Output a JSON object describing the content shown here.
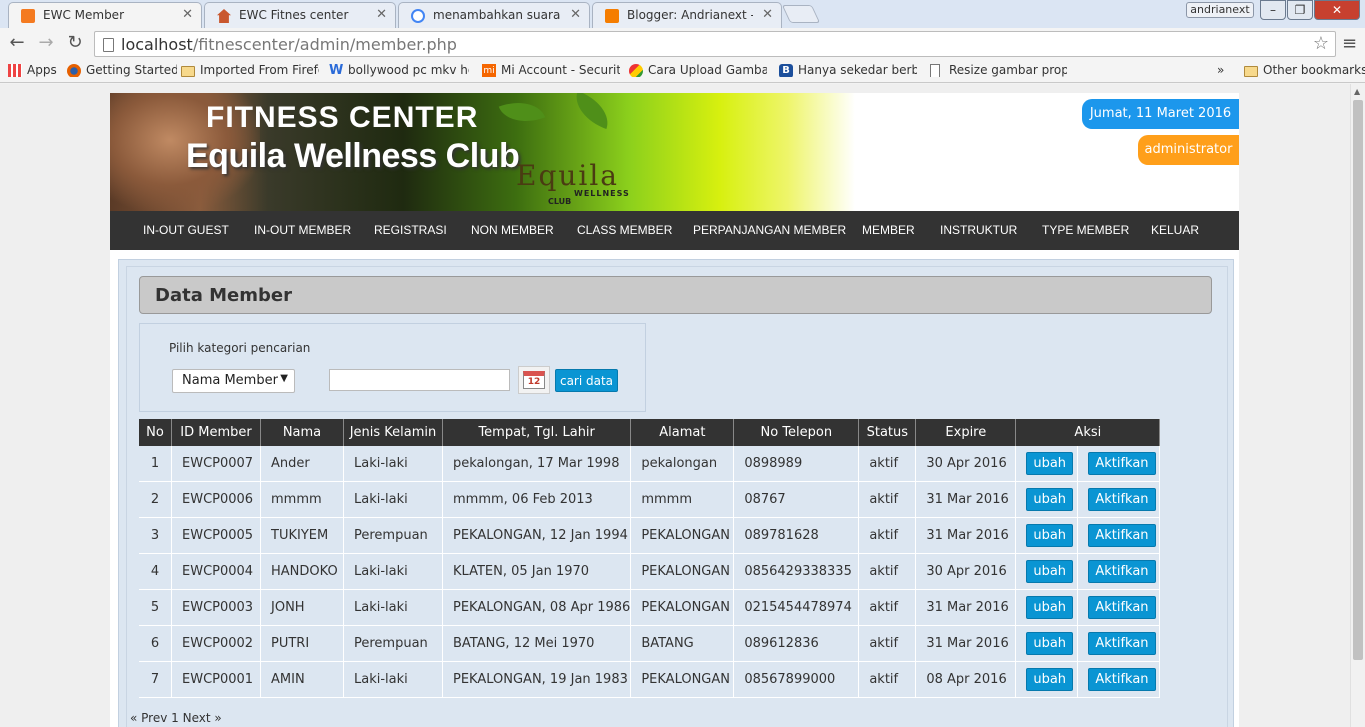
{
  "browser": {
    "tabs": [
      {
        "title": "EWC Member",
        "icon": "xampp-icon",
        "active": true
      },
      {
        "title": "EWC Fitnes center",
        "icon": "house-icon",
        "active": false
      },
      {
        "title": "menambahkan suara pada",
        "icon": "google-icon",
        "active": false
      },
      {
        "title": "Blogger: Andrianext - Cre",
        "icon": "blogger-icon",
        "active": false
      }
    ],
    "profile_name": "andrianext",
    "url_host": "localhost",
    "url_path": "/fitnescenter/admin/member.php",
    "bookmarks": [
      {
        "label": "Apps",
        "icon": "apps-grid-icon"
      },
      {
        "label": "Getting Started",
        "icon": "firefox-icon"
      },
      {
        "label": "Imported From Firefox",
        "icon": "folder-icon"
      },
      {
        "label": "bollywood pc mkv hd",
        "icon": "w-icon"
      },
      {
        "label": "Mi Account - Security",
        "icon": "mi-icon"
      },
      {
        "label": "Cara Upload Gambar",
        "icon": "upload-icon"
      },
      {
        "label": "Hanya sekedar berbagi",
        "icon": "b-icon"
      },
      {
        "label": "Resize gambar propor",
        "icon": "page-icon"
      }
    ],
    "overflow_label": "»",
    "other_bookmarks": "Other bookmarks"
  },
  "header": {
    "title_line1": "FITNESS CENTER",
    "title_line2": "Equila Wellness Club",
    "logo_text": "Equila",
    "logo_sub1": "WELLNESS",
    "logo_sub2": "CLUB",
    "date": "Jumat, 11 Maret 2016",
    "user": "administrator"
  },
  "nav": [
    "IN-OUT GUEST",
    "IN-OUT MEMBER",
    "REGISTRASI",
    "NON MEMBER",
    "CLASS MEMBER",
    "PERPANJANGAN MEMBER",
    "MEMBER",
    "INSTRUKTUR",
    "TYPE MEMBER",
    "KELUAR"
  ],
  "main": {
    "section_title": "Data Member",
    "search": {
      "label": "Pilih kategori pencarian",
      "category": "Nama Member",
      "calendar_day": "12",
      "button": "cari data"
    },
    "columns": [
      "No",
      "ID Member",
      "Nama",
      "Jenis Kelamin",
      "Tempat, Tgl. Lahir",
      "Alamat",
      "No Telepon",
      "Status",
      "Expire",
      "Aksi"
    ],
    "rows": [
      {
        "no": "1",
        "id": "EWCP0007",
        "nama": "Ander",
        "jk": "Laki-laki",
        "ttl": "pekalongan, 17 Mar 1998",
        "alamat": "pekalongan",
        "telp": "0898989",
        "status": "aktif",
        "expire": "30 Apr 2016",
        "edit": "ubah",
        "action": "Aktifkan"
      },
      {
        "no": "2",
        "id": "EWCP0006",
        "nama": "mmmm",
        "jk": "Laki-laki",
        "ttl": "mmmm, 06 Feb 2013",
        "alamat": "mmmm",
        "telp": "08767",
        "status": "aktif",
        "expire": "31 Mar 2016",
        "edit": "ubah",
        "action": "Aktifkan"
      },
      {
        "no": "3",
        "id": "EWCP0005",
        "nama": "TUKIYEM",
        "jk": "Perempuan",
        "ttl": "PEKALONGAN, 12 Jan 1994",
        "alamat": "PEKALONGAN",
        "telp": "089781628",
        "status": "aktif",
        "expire": "31 Mar 2016",
        "edit": "ubah",
        "action": "Aktifkan"
      },
      {
        "no": "4",
        "id": "EWCP0004",
        "nama": "HANDOKO",
        "jk": "Laki-laki",
        "ttl": "KLATEN, 05 Jan 1970",
        "alamat": "PEKALONGAN",
        "telp": "0856429338335",
        "status": "aktif",
        "expire": "30 Apr 2016",
        "edit": "ubah",
        "action": "Aktifkan"
      },
      {
        "no": "5",
        "id": "EWCP0003",
        "nama": "JONH",
        "jk": "Laki-laki",
        "ttl": "PEKALONGAN, 08 Apr 1986",
        "alamat": "PEKALONGAN",
        "telp": "0215454478974",
        "status": "aktif",
        "expire": "31 Mar 2016",
        "edit": "ubah",
        "action": "Aktifkan"
      },
      {
        "no": "6",
        "id": "EWCP0002",
        "nama": "PUTRI",
        "jk": "Perempuan",
        "ttl": "BATANG, 12 Mei 1970",
        "alamat": "BATANG",
        "telp": "089612836",
        "status": "aktif",
        "expire": "31 Mar 2016",
        "edit": "ubah",
        "action": "Aktifkan"
      },
      {
        "no": "7",
        "id": "EWCP0001",
        "nama": "AMIN",
        "jk": "Laki-laki",
        "ttl": "PEKALONGAN, 19 Jan 1983",
        "alamat": "PEKALONGAN",
        "telp": "08567899000",
        "status": "aktif",
        "expire": "08 Apr 2016",
        "edit": "ubah",
        "action": "Aktifkan"
      }
    ],
    "pager": {
      "prev": "« Prev",
      "page": "1",
      "next": "Next »"
    }
  },
  "colors": {
    "nav_bg": "#333333",
    "content_bg": "#dce6f1",
    "button_blue": "#0a95d3",
    "date_badge": "#1c97ec",
    "user_badge": "#ff9f1a"
  }
}
